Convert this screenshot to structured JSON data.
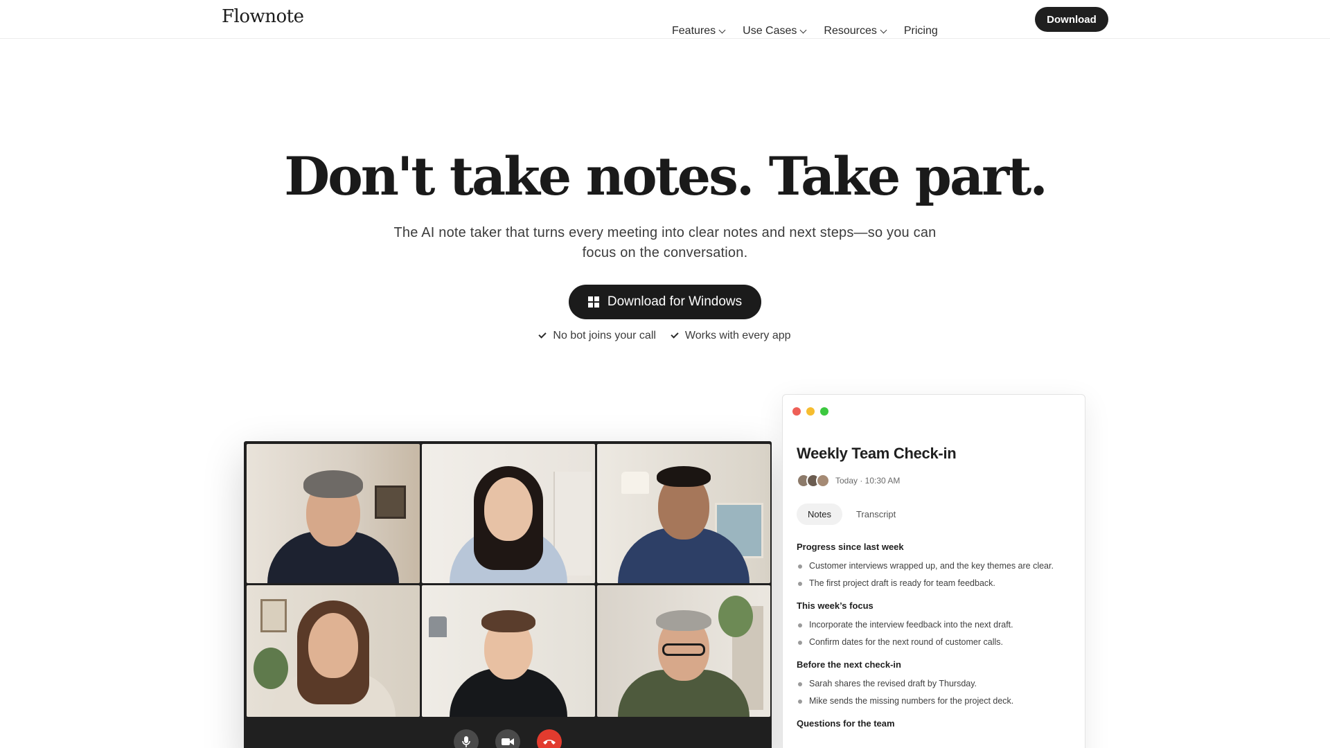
{
  "header": {
    "logo": "Flownote",
    "nav": [
      {
        "label": "Features",
        "dropdown": true
      },
      {
        "label": "Use Cases",
        "dropdown": true
      },
      {
        "label": "Resources",
        "dropdown": true
      },
      {
        "label": "Pricing",
        "dropdown": false
      }
    ],
    "download_label": "Download"
  },
  "hero": {
    "title": "Don't take notes. Take part.",
    "subtitle": "The AI note taker that turns every meeting into clear notes and next steps—so you can focus on the conversation.",
    "cta_label": "Download for Windows",
    "cta_icon": "windows-icon",
    "checks": [
      "No bot joins your call",
      "Works with every app"
    ]
  },
  "call": {
    "controls": [
      "microphone-icon",
      "camera-icon",
      "end-call-icon"
    ],
    "colors": {
      "end": "#e23b2e",
      "control": "#4a4a4a"
    }
  },
  "notes": {
    "window_dots": [
      "#ee5f57",
      "#f6bd2f",
      "#3cc83f"
    ],
    "title": "Weekly Team Check-in",
    "meta": "Today · 10:30 AM",
    "tabs": [
      "Notes",
      "Transcript"
    ],
    "sections": [
      {
        "heading": "Progress since last week",
        "items": [
          "Customer interviews wrapped up, and the key themes are clear.",
          "The first project draft is ready for team feedback."
        ]
      },
      {
        "heading": "This week’s focus",
        "items": [
          "Incorporate the interview feedback into the next draft.",
          "Confirm dates for the next round of customer calls."
        ]
      },
      {
        "heading": "Before the next check-in",
        "items": [
          "Sarah shares the revised draft by Thursday.",
          "Mike sends the missing numbers for the project deck."
        ]
      },
      {
        "heading": "Questions for the team",
        "items": []
      }
    ]
  }
}
